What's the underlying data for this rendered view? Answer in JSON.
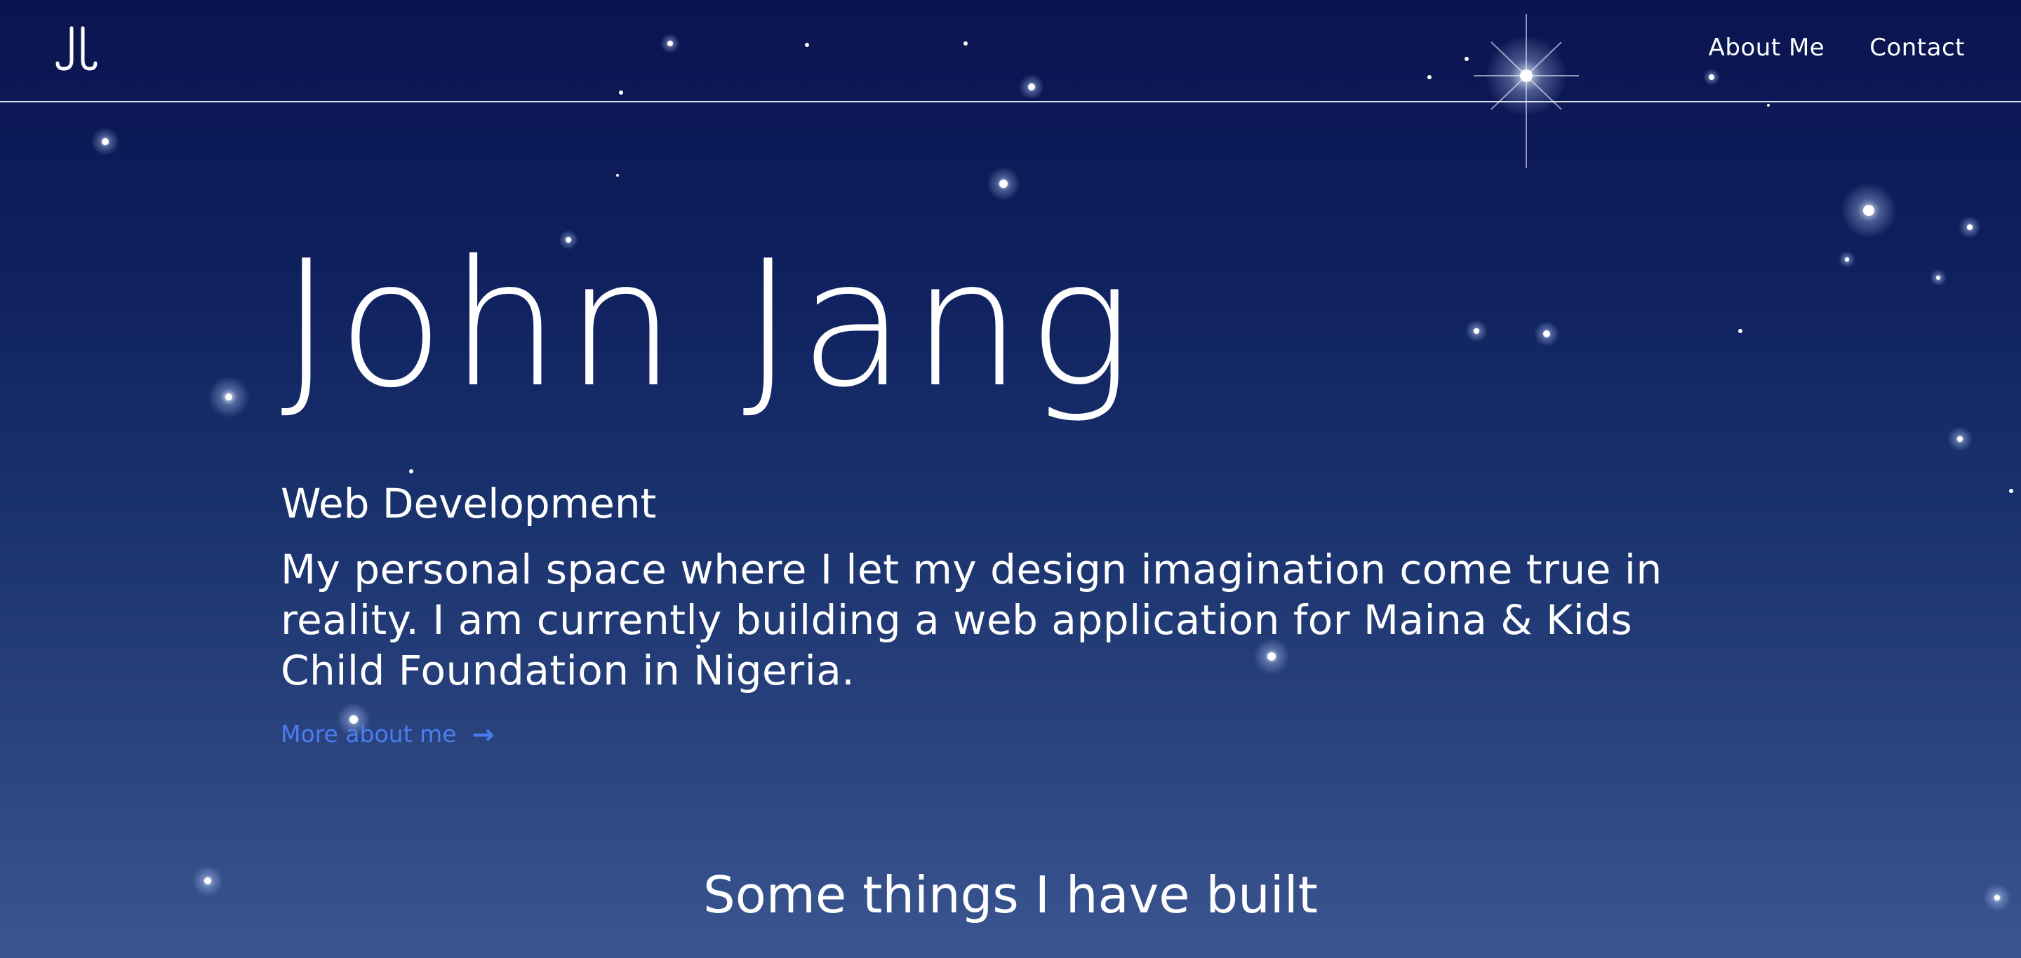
{
  "nav": {
    "about_label": "About Me",
    "contact_label": "Contact"
  },
  "logo": {
    "icon": "jj-monogram-icon"
  },
  "hero": {
    "name": "John Jang",
    "subtitle": "Web Development",
    "description": "My personal space where I let my design imagination come true in reality. I am currently building a web application for Maina & Kids Child Foundation in Nigeria.",
    "more_link_label": "More about me",
    "more_link_icon": "arrow-right-icon"
  },
  "projects": {
    "heading": "Some things I have built"
  },
  "colors": {
    "background_top": "#0a1450",
    "background_bottom": "#3a5590",
    "text": "#ffffff",
    "link": "#4c7df0"
  }
}
